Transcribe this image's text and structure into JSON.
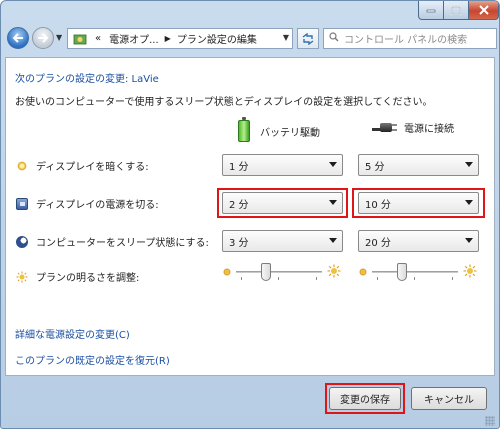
{
  "address": {
    "path": [
      "«",
      "電源オプ...",
      "プラン設定の編集"
    ],
    "search_placeholder": "コントロール パネルの検索"
  },
  "plan": {
    "title": "次のプランの設定の変更: LaVie",
    "description": "お使いのコンピューターで使用するスリープ状態とディスプレイの設定を選択してください。"
  },
  "columns": {
    "battery": "バッテリ駆動",
    "ac": "電源に接続"
  },
  "settings": [
    {
      "label": "ディスプレイを暗くする:",
      "icon": "dim-display-icon",
      "battery": "1 分",
      "ac": "5 分"
    },
    {
      "label": "ディスプレイの電源を切る:",
      "icon": "display-off-icon",
      "battery": "2 分",
      "ac": "10 分",
      "highlighted": true
    },
    {
      "label": "コンピューターをスリープ状態にする:",
      "icon": "sleep-icon",
      "battery": "3 分",
      "ac": "20 分"
    }
  ],
  "brightness": {
    "label": "プランの明るさを調整:",
    "icon": "brightness-icon",
    "battery_level": 0.33,
    "ac_level": 0.33
  },
  "links": {
    "advanced": "詳細な電源設定の変更(C)",
    "restore": "このプランの既定の設定を復元(R)"
  },
  "buttons": {
    "save": "変更の保存",
    "cancel": "キャンセル"
  },
  "colors": {
    "highlight": "#e01515",
    "link": "#1a4fa3"
  }
}
